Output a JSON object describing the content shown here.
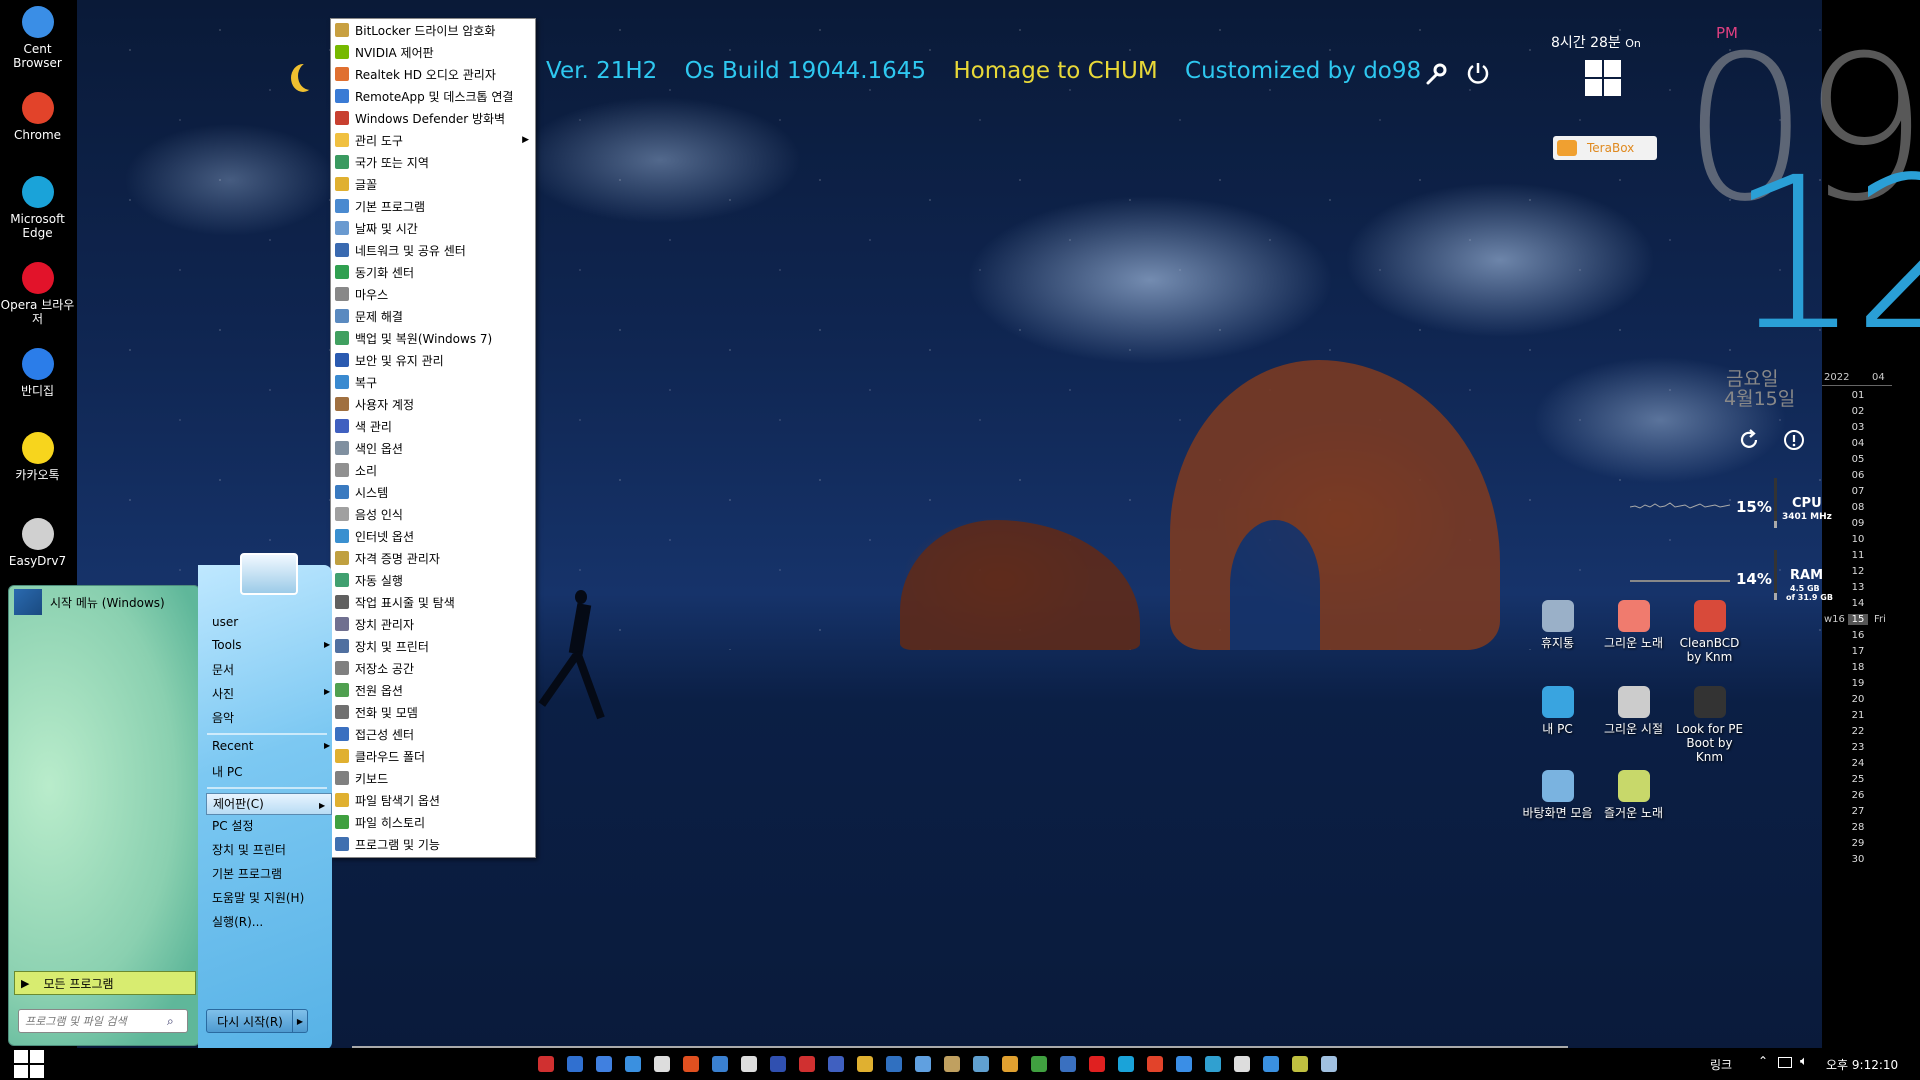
{
  "desktop_left": [
    {
      "label": "Cent Browser",
      "icon": "cent-browser-icon",
      "color": "#3a8ee6"
    },
    {
      "label": "Chrome",
      "icon": "chrome-icon",
      "color": "#e2432a"
    },
    {
      "label": "Microsoft Edge",
      "icon": "edge-icon",
      "color": "#1aa3d9"
    },
    {
      "label": "Opera 브라우저",
      "icon": "opera-icon",
      "color": "#e2132a"
    },
    {
      "label": "반디집",
      "icon": "bandizip-icon",
      "color": "#2b7de9"
    },
    {
      "label": "카카오톡",
      "icon": "kakaotalk-icon",
      "color": "#f7d51d"
    },
    {
      "label": "EasyDrv7",
      "icon": "easydrv-icon",
      "color": "#d0d0d0"
    }
  ],
  "topline": {
    "version": "Ver. 21H2",
    "build": "Os Build 19044.1645",
    "homage": "Homage to CHUM",
    "customized": "Customized  by do98"
  },
  "clock": {
    "uptime": "8시간 28분",
    "uptime_suffix": "On",
    "ampm": "PM",
    "hour": "09",
    "minute": "12",
    "weekday": "금요일",
    "date": "4월15일",
    "terabox": "TeraBox"
  },
  "calendar": {
    "year": "2022",
    "month": "04",
    "week": "w16",
    "today": "15",
    "today_day": "Fri",
    "days": [
      "01",
      "02",
      "03",
      "04",
      "05",
      "06",
      "07",
      "08",
      "09",
      "10",
      "11",
      "12",
      "13",
      "14",
      "15",
      "16",
      "17",
      "18",
      "19",
      "20",
      "21",
      "22",
      "23",
      "24",
      "25",
      "26",
      "27",
      "28",
      "29",
      "30"
    ]
  },
  "meters": {
    "cpu_percent": "15%",
    "cpu_label": "CPU",
    "cpu_detail": "3401 MHz",
    "cpu_value": 0.15,
    "ram_percent": "14%",
    "ram_label": "RAM",
    "ram_detail1": "4.5 GB",
    "ram_detail2": "of 31.9 GB",
    "ram_value": 0.14
  },
  "desktop_right": [
    {
      "label": "휴지통",
      "icon": "recycle-bin-icon",
      "color": "#9ab0c8"
    },
    {
      "label": "그리운 노래",
      "icon": "music-note-icon",
      "color": "#f07b6e"
    },
    {
      "label": "CleanBCD by Knm",
      "icon": "cleanbcd-icon",
      "color": "#d84a3a"
    },
    {
      "label": "내 PC",
      "icon": "computer-icon",
      "color": "#39a4e0"
    },
    {
      "label": "그리운 시절",
      "icon": "speaker-icon",
      "color": "#cccccc"
    },
    {
      "label": "Look for PE Boot by Knm",
      "icon": "magnifier-icon",
      "color": "#333333"
    },
    {
      "label": "바탕화면 모음",
      "icon": "desktop-image-icon",
      "color": "#7ab3e0"
    },
    {
      "label": "즐거운 노래",
      "icon": "cd-icon",
      "color": "#c8d86a"
    }
  ],
  "control_panel": [
    {
      "label": "BitLocker 드라이브 암호화",
      "color": "#c8a040"
    },
    {
      "label": "NVIDIA 제어판",
      "color": "#76b900"
    },
    {
      "label": "Realtek HD 오디오 관리자",
      "color": "#e07030"
    },
    {
      "label": "RemoteApp 및 데스크톱 연결",
      "color": "#3a7bd5"
    },
    {
      "label": "Windows Defender 방화벽",
      "color": "#c84030"
    },
    {
      "label": "관리 도구",
      "color": "#f0c040",
      "submenu": true
    },
    {
      "label": "국가 또는 지역",
      "color": "#3a9a60"
    },
    {
      "label": "글꼴",
      "color": "#e0b030"
    },
    {
      "label": "기본 프로그램",
      "color": "#4a8ad0"
    },
    {
      "label": "날짜 및 시간",
      "color": "#6a9ad0"
    },
    {
      "label": "네트워크 및 공유 센터",
      "color": "#3a6ab0"
    },
    {
      "label": "동기화 센터",
      "color": "#30a050"
    },
    {
      "label": "마우스",
      "color": "#888888"
    },
    {
      "label": "문제 해결",
      "color": "#5a8ac0"
    },
    {
      "label": "백업 및 복원(Windows 7)",
      "color": "#40a060"
    },
    {
      "label": "보안 및 유지 관리",
      "color": "#2a5ab0"
    },
    {
      "label": "복구",
      "color": "#3a8ad0"
    },
    {
      "label": "사용자 계정",
      "color": "#a07040"
    },
    {
      "label": "색 관리",
      "color": "#4060c0"
    },
    {
      "label": "색인 옵션",
      "color": "#8090a0"
    },
    {
      "label": "소리",
      "color": "#909090"
    },
    {
      "label": "시스템",
      "color": "#3a7ac0"
    },
    {
      "label": "음성 인식",
      "color": "#a0a0a0"
    },
    {
      "label": "인터넷 옵션",
      "color": "#3a90d0"
    },
    {
      "label": "자격 증명 관리자",
      "color": "#c0a040"
    },
    {
      "label": "자동 실행",
      "color": "#40a070"
    },
    {
      "label": "작업 표시줄 및 탐색",
      "color": "#606060"
    },
    {
      "label": "장치 관리자",
      "color": "#707090"
    },
    {
      "label": "장치 및 프린터",
      "color": "#5070a0"
    },
    {
      "label": "저장소 공간",
      "color": "#808080"
    },
    {
      "label": "전원 옵션",
      "color": "#50a050"
    },
    {
      "label": "전화 및 모뎀",
      "color": "#707070"
    },
    {
      "label": "접근성 센터",
      "color": "#3a70c0"
    },
    {
      "label": "클라우드 폴더",
      "color": "#e0b030"
    },
    {
      "label": "키보드",
      "color": "#808080"
    },
    {
      "label": "파일 탐색기 옵션",
      "color": "#e0b030"
    },
    {
      "label": "파일 히스토리",
      "color": "#40a040"
    },
    {
      "label": "프로그램 및 기능",
      "color": "#4070b0"
    }
  ],
  "start_menu": {
    "header": "시작 메뉴 (Windows)",
    "all_programs": "모든 프로그램",
    "search_placeholder": "프로그램 및 파일 검색",
    "items_top": [
      "user",
      "Tools",
      "문서",
      "사진",
      "음악"
    ],
    "items_mid": [
      "Recent",
      "내 PC"
    ],
    "control_panel": "제어판(C)",
    "items_bottom": [
      "PC 설정",
      "장치 및 프린터",
      "기본 프로그램",
      "도움말 및 지원(H)",
      "실행(R)..."
    ],
    "restart": "다시 시작(R)"
  },
  "tray": {
    "links": "링크",
    "time": "오후 9:12:10"
  },
  "taskbar_icons": [
    "#d03030",
    "#3070d0",
    "#4080e0",
    "#3a90e0",
    "#dddddd",
    "#e05020",
    "#3a80d0",
    "#dddddd",
    "#3050b0",
    "#d03030",
    "#4060c0",
    "#e0b030",
    "#3070c0",
    "#60a0e0",
    "#c0a060",
    "#60a0d0",
    "#e0a030",
    "#40a040",
    "#3a70c0",
    "#e02020",
    "#1aa3d9",
    "#e2432a",
    "#3a8ee6",
    "#30a0d0",
    "#dddddd",
    "#3a90e0",
    "#c0c040",
    "#a0c0e0"
  ]
}
